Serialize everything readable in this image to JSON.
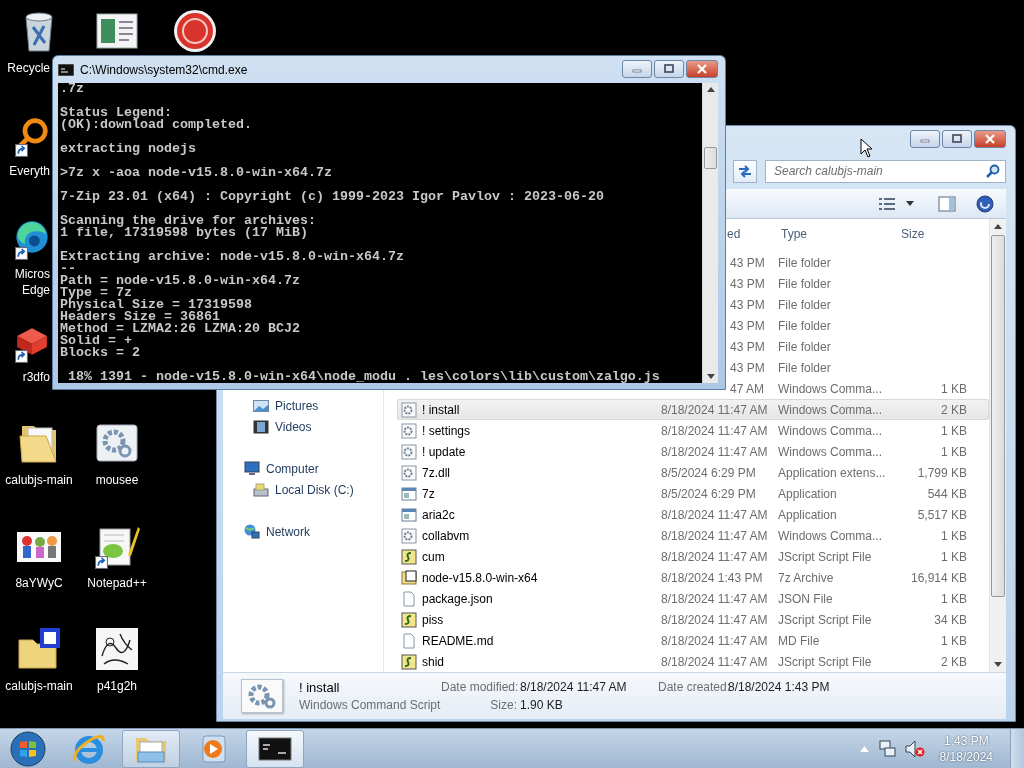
{
  "desktop": {
    "rows": [
      [
        {
          "kind": "recycle-bin",
          "label": "Recycle",
          "shortcut": false
        },
        {
          "kind": "window-app",
          "shortcut": false
        },
        {
          "kind": "red-disc",
          "shortcut": false
        }
      ],
      [
        {
          "kind": "ring-app",
          "label": "Everyth",
          "shortcut": true
        }
      ],
      [
        {
          "kind": "swirl",
          "label": "Micros\nEdge",
          "shortcut": true
        }
      ],
      [
        {
          "kind": "cube",
          "label": "r3dfo",
          "shortcut": true
        }
      ],
      [
        {
          "kind": "folder",
          "label": "calubjs-main",
          "shortcut": false
        },
        {
          "kind": "gear-doc",
          "label": "mousee",
          "shortcut": false
        }
      ],
      [
        {
          "kind": "cartoon",
          "label": "8aYWyC",
          "shortcut": false
        },
        {
          "kind": "notepad",
          "label": "Notepad++",
          "shortcut": true
        }
      ],
      [
        {
          "kind": "zip-folder",
          "label": "calubjs-main",
          "shortcut": false
        },
        {
          "kind": "sketch",
          "label": "p41g2h",
          "shortcut": false
        }
      ]
    ]
  },
  "cmd": {
    "title": "C:\\Windows\\system32\\cmd.exe",
    "blocks": [
      [
        ".7z"
      ],
      [
        "Status Legend:",
        "(OK):download completed."
      ],
      [
        "extracting nodejs"
      ],
      [
        ">7z x -aoa node-v15.8.0-win-x64.7z"
      ],
      [
        "7-Zip 23.01 (x64) : Copyright (c) 1999-2023 Igor Pavlov : 2023-06-20"
      ],
      [
        "Scanning the drive for archives:",
        "1 file, 17319598 bytes (17 MiB)"
      ],
      [
        "Extracting archive: node-v15.8.0-win-x64.7z",
        "--",
        "Path = node-v15.8.0-win-x64.7z",
        "Type = 7z",
        "Physical Size = 17319598",
        "Headers Size = 36861",
        "Method = LZMA2:26 LZMA:20 BCJ2",
        "Solid = +",
        "Blocks = 2"
      ],
      [
        " 18% 1391 - node-v15.8.0-win-x64\\node_modu . les\\colors\\lib\\custom\\zalgo.js"
      ]
    ]
  },
  "explorer": {
    "search": {
      "placeholder": "Search calubjs-main"
    },
    "columns": [
      {
        "label": "ed"
      },
      {
        "label": "Type"
      },
      {
        "label": "Size"
      }
    ],
    "nav": [
      {
        "label": "Pictures",
        "kind": "pictures"
      },
      {
        "label": "Videos",
        "kind": "videos"
      },
      {
        "label": "Computer",
        "kind": "computer"
      },
      {
        "label": "Local Disk (C:)",
        "kind": "disk"
      },
      {
        "label": "Network",
        "kind": "network"
      }
    ],
    "rows": [
      {
        "date": "43 PM",
        "type": "File folder",
        "selected": false
      },
      {
        "date": "43 PM",
        "type": "File folder",
        "selected": false
      },
      {
        "date": "43 PM",
        "type": "File folder",
        "selected": false
      },
      {
        "date": "43 PM",
        "type": "File folder",
        "selected": false
      },
      {
        "date": "43 PM",
        "type": "File folder",
        "selected": false
      },
      {
        "date": "43 PM",
        "type": "File folder",
        "selected": false
      },
      {
        "date": "47 AM",
        "type": "Windows Comma...",
        "size": "1 KB",
        "selected": false
      },
      {
        "name": "! install",
        "kind": "cmd-script",
        "date": "8/18/2024 11:47 AM",
        "type": "Windows Comma...",
        "size": "2 KB",
        "selected": true
      },
      {
        "name": "! settings",
        "kind": "cmd-script",
        "date": "8/18/2024 11:47 AM",
        "type": "Windows Comma...",
        "size": "1 KB",
        "selected": false
      },
      {
        "name": "! update",
        "kind": "cmd-script",
        "date": "8/18/2024 11:47 AM",
        "type": "Windows Comma...",
        "size": "1 KB",
        "selected": false
      },
      {
        "name": "7z.dll",
        "kind": "dll",
        "date": "8/5/2024 6:29 PM",
        "type": "Application extens...",
        "size": "1,799 KB",
        "selected": false
      },
      {
        "name": "7z",
        "kind": "app",
        "date": "8/5/2024 6:29 PM",
        "type": "Application",
        "size": "544 KB",
        "selected": false
      },
      {
        "name": "aria2c",
        "kind": "app",
        "date": "8/18/2024 11:47 AM",
        "type": "Application",
        "size": "5,517 KB",
        "selected": false
      },
      {
        "name": "collabvm",
        "kind": "cmd-script",
        "date": "8/18/2024 11:47 AM",
        "type": "Windows Comma...",
        "size": "1 KB",
        "selected": false
      },
      {
        "name": "cum",
        "kind": "js",
        "date": "8/18/2024 11:47 AM",
        "type": "JScript Script File",
        "size": "1 KB",
        "selected": false
      },
      {
        "name": "node-v15.8.0-win-x64",
        "kind": "archive",
        "date": "8/18/2024 1:43 PM",
        "type": "7z Archive",
        "size": "16,914 KB",
        "selected": false
      },
      {
        "name": "package.json",
        "kind": "file",
        "date": "8/18/2024 11:47 AM",
        "type": "JSON File",
        "size": "1 KB",
        "selected": false
      },
      {
        "name": "piss",
        "kind": "js",
        "date": "8/18/2024 11:47 AM",
        "type": "JScript Script File",
        "size": "34 KB",
        "selected": false
      },
      {
        "name": "README.md",
        "kind": "file",
        "date": "8/18/2024 11:47 AM",
        "type": "MD File",
        "size": "1 KB",
        "selected": false
      },
      {
        "name": "shid",
        "kind": "js",
        "date": "8/18/2024 11:47 AM",
        "type": "JScript Script File",
        "size": "2 KB",
        "selected": false
      }
    ],
    "details": {
      "name": "! install",
      "type": "Windows Command Script",
      "fields": [
        {
          "label": "Date modified:",
          "value": "8/18/2024 11:47 AM"
        },
        {
          "label": "Date created:",
          "value": "8/18/2024 1:43 PM"
        },
        {
          "label": "Size:",
          "value": "1.90 KB"
        }
      ]
    }
  },
  "taskbar": {
    "buttons": [
      {
        "kind": "browser",
        "open": false,
        "selected": false
      },
      {
        "kind": "explorer",
        "open": true,
        "selected": false
      },
      {
        "kind": "media",
        "open": false,
        "selected": false
      },
      {
        "kind": "console",
        "open": true,
        "selected": true
      }
    ],
    "clock": {
      "time": "1:43 PM",
      "date": "8/18/2024"
    }
  }
}
